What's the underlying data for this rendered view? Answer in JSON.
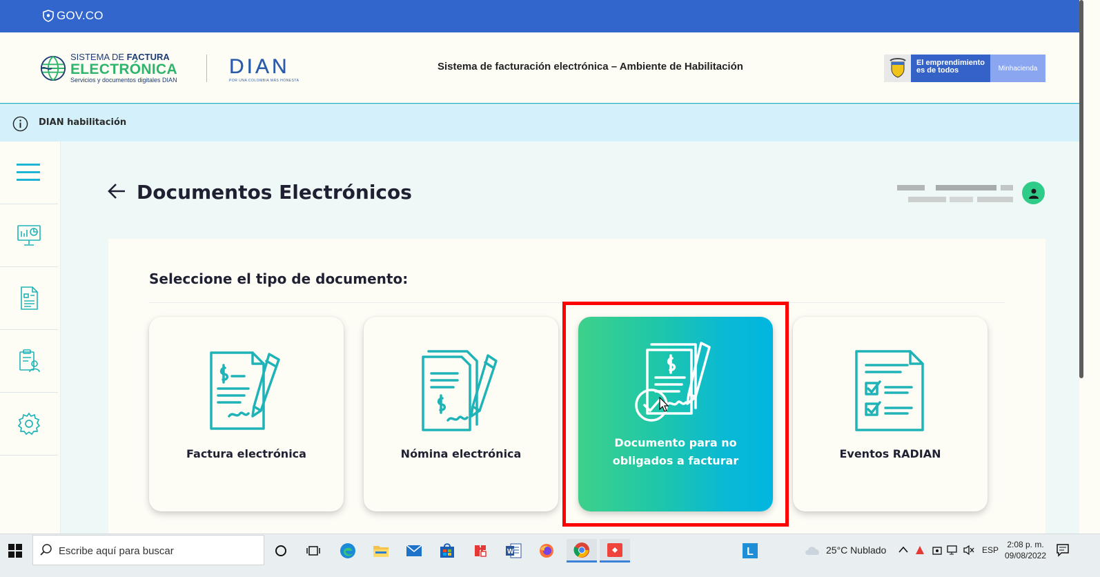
{
  "gov_bar": {
    "logo_text": "GOV.CO"
  },
  "header": {
    "brand_line1_a": "SISTEMA DE ",
    "brand_line1_b": "FACTURA",
    "brand_line2": "ELECTRÓNICA",
    "brand_line3": "Servicios y documentos digitales DIAN",
    "dian_word": "DIAN",
    "dian_sub": "POR UNA COLOMBIA MÁS HONESTA",
    "title": "Sistema de facturación electrónica – Ambiente de Habilitación",
    "ministry_text": "El emprendimiento es de todos",
    "ministry_name": "Minhacienda"
  },
  "info_bar": {
    "text": "DIAN habilitación"
  },
  "sidebar": {
    "items": [
      "menu",
      "dashboard",
      "documents",
      "reports",
      "settings"
    ]
  },
  "main": {
    "page_title": "Documentos Electrónicos",
    "section_title": "Seleccione el tipo de documento:",
    "cards": [
      {
        "label": "Factura electrónica",
        "icon": "invoice-pen-icon",
        "active": false
      },
      {
        "label": "Nómina electrónica",
        "icon": "payroll-pen-icon",
        "active": false
      },
      {
        "label": "Documento para no obligados a facturar",
        "icon": "signed-document-icon",
        "active": true
      },
      {
        "label": "Eventos RADIAN",
        "icon": "checklist-icon",
        "active": false
      }
    ]
  },
  "taskbar": {
    "search_placeholder": "Escribe aquí para buscar",
    "weather": "25°C  Nublado",
    "language": "ESP",
    "time": "2:08 p. m.",
    "date": "09/08/2022"
  },
  "colors": {
    "gov_blue": "#3366cc",
    "brand_green": "#2eb56b",
    "card_gradient_start": "#3ed08a",
    "card_gradient_end": "#00b6e0",
    "highlight": "#ff0000"
  }
}
